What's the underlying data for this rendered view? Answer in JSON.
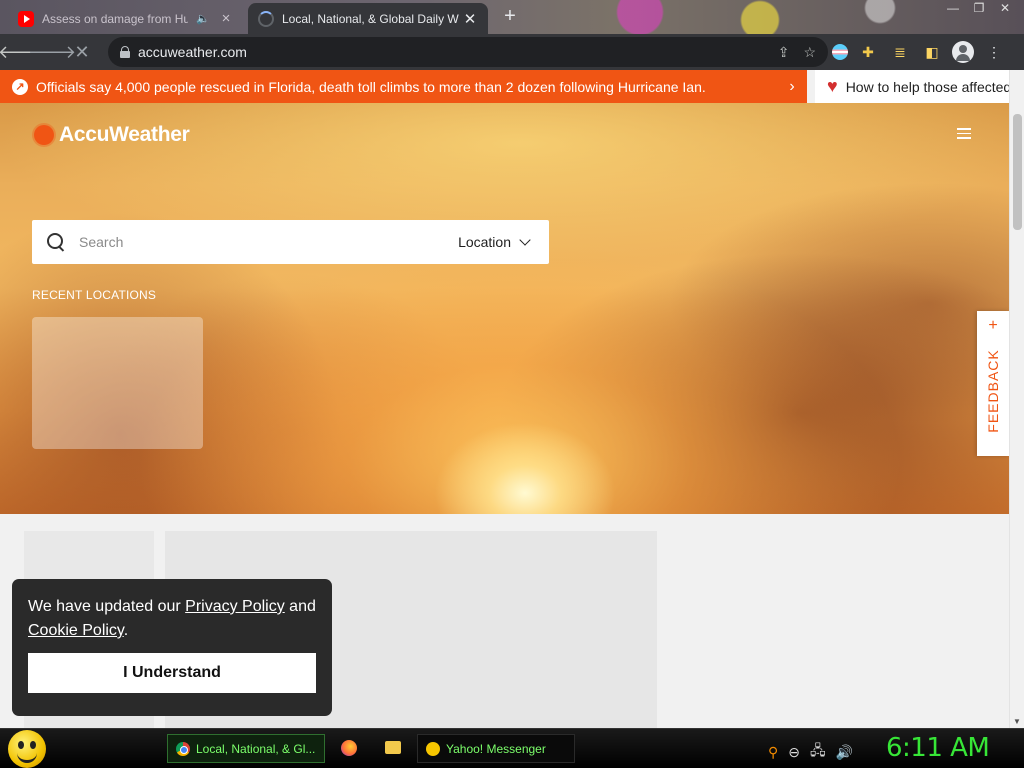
{
  "browser": {
    "tabs": [
      {
        "title": "Assess on damage from Hur",
        "icon": "youtube-icon",
        "active": false
      },
      {
        "title": "Local, National, & Global Daily W",
        "icon": "loading-spinner-icon",
        "active": true
      }
    ],
    "url": "accuweather.com",
    "new_tab_symbol": "+",
    "window_controls": [
      "—",
      "❐",
      "✕"
    ]
  },
  "site": {
    "alert": {
      "text": "Officials say 4,000 people rescued in Florida, death toll climbs to more than 2 dozen following Hurricane Ian.",
      "chevron": "›"
    },
    "help_link": "How to help those affected",
    "logo": "AccuWeather",
    "search": {
      "placeholder": "Search",
      "type_label": "Location"
    },
    "recent_locations_label": "RECENT LOCATIONS",
    "feedback": {
      "label": "FEEDBACK",
      "plus": "+"
    },
    "cookie": {
      "text_before": "We have updated our ",
      "privacy_link": "Privacy Policy",
      "text_middle": " and ",
      "cookie_link": "Cookie Policy",
      "text_after": ".",
      "button": "I Understand"
    }
  },
  "taskbar": {
    "items": [
      {
        "label": "Local, National, & Gl...",
        "icon": "chrome-icon"
      },
      {
        "label": "Yahoo! Messenger",
        "icon": "yahoo-messenger-icon"
      }
    ],
    "clock": "6:11 AM"
  },
  "colors": {
    "accent": "#f05514",
    "clock_green": "#37e637"
  }
}
